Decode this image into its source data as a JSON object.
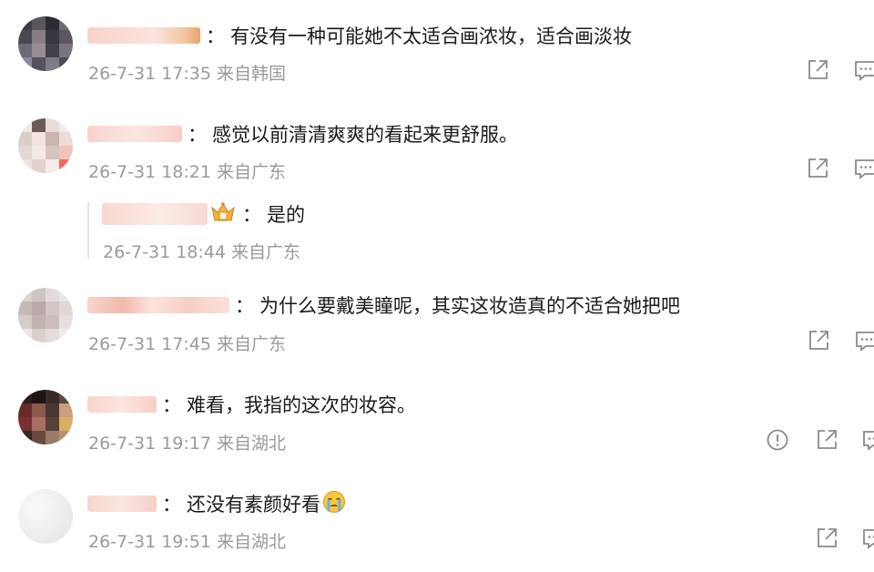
{
  "comments": [
    {
      "text": "有没有一种可能她不太适合画浓妆，适合画淡妆",
      "time": "26-7-31 17:35",
      "location": "来自韩国"
    },
    {
      "text": "感觉以前清清爽爽的看起来更舒服。",
      "time": "26-7-31 18:21",
      "location": "来自广东"
    },
    {
      "text": "为什么要戴美瞳呢，其实这妆造真的不适合她把吧",
      "time": "26-7-31 17:45",
      "location": "来自广东"
    },
    {
      "text": "难看，我指的这次的妆容。",
      "time": "26-7-31 19:17",
      "location": "来自湖北"
    },
    {
      "text": "还没有素颜好看",
      "time": "26-7-31 19:51",
      "location": "来自湖北"
    }
  ],
  "reply": {
    "text": "是的",
    "time": "26-7-31 18:44",
    "location": "来自广东"
  },
  "separator": "：",
  "icons": [
    "share-icon",
    "comment-icon",
    "report-icon",
    "crown-badge-icon",
    "crying-emoji-icon"
  ],
  "colors": {
    "meta_gray": "#9a9a9a",
    "icon_gray": "#8a8a8a",
    "username_blur": "#f6c7bd"
  }
}
